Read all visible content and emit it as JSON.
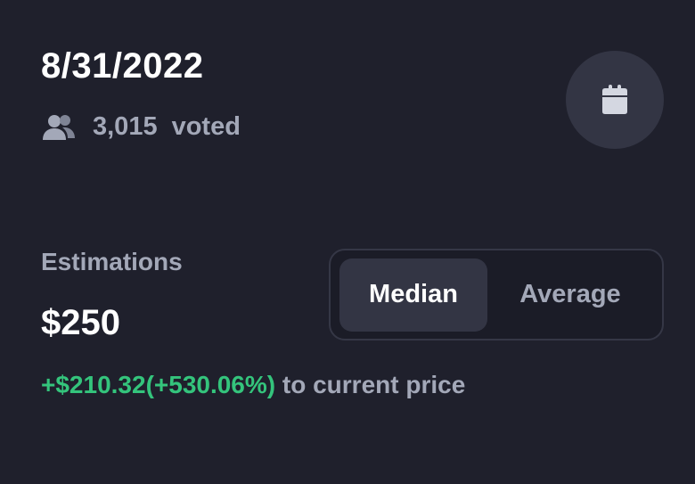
{
  "prediction": {
    "date": "8/31/2022",
    "votes_count": "3,015",
    "votes_label": "voted"
  },
  "icons": {
    "voters": "people-icon",
    "calendar": "calendar-icon"
  },
  "estimation": {
    "label": "Estimations",
    "value": "$250",
    "delta": "+$210.32(+530.06%)",
    "delta_suffix": "to current price"
  },
  "mode_toggle": {
    "options": [
      "Median",
      "Average"
    ],
    "selected": "Median"
  },
  "colors": {
    "background": "#1f202c",
    "positive": "#34c47c",
    "muted_text": "#a3a8b8"
  }
}
